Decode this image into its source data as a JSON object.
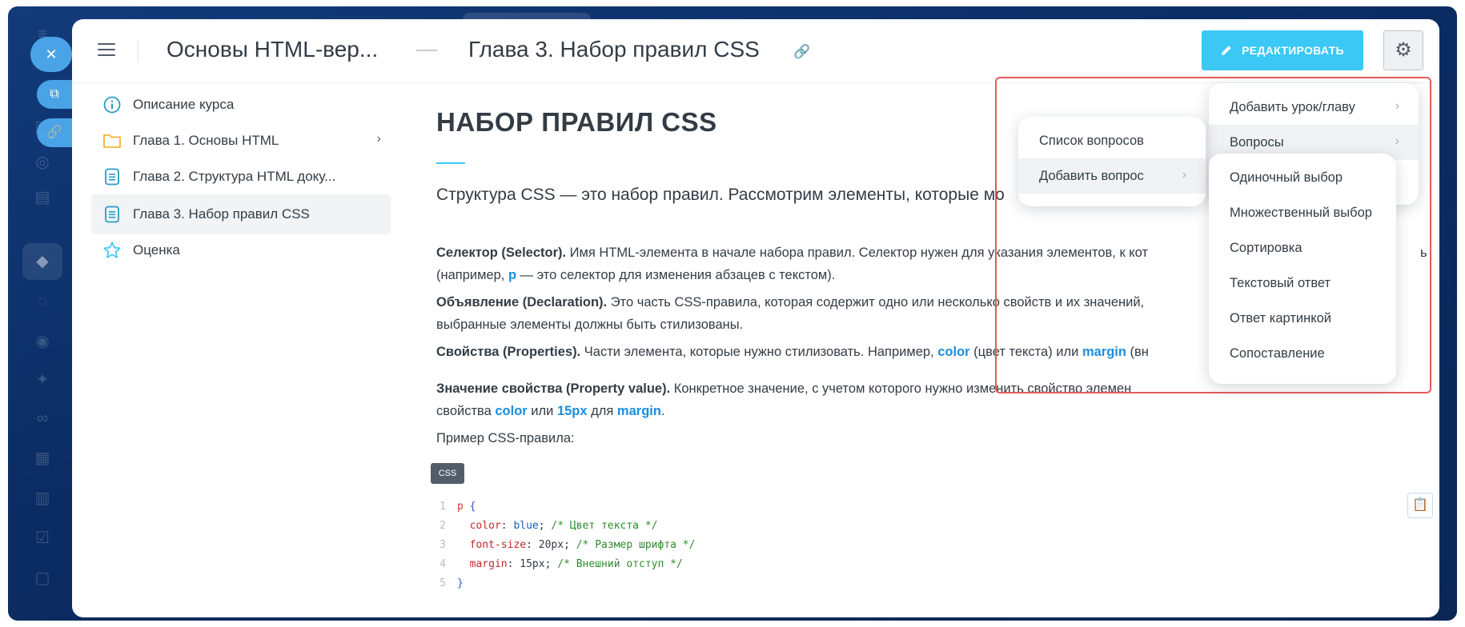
{
  "header": {
    "course_title": "Основы HTML-вер...",
    "chapter_title": "Глава 3. Набор правил CSS",
    "edit_button": "РЕДАКТИРОВАТЬ"
  },
  "sidebar": {
    "items": [
      {
        "label": "Описание курса",
        "icon": "info-icon"
      },
      {
        "label": "Глава 1. Основы HTML",
        "icon": "folder-icon",
        "has_children": true
      },
      {
        "label": "Глава 2. Структура HTML доку...",
        "icon": "document-icon"
      },
      {
        "label": "Глава 3. Набор правил CSS",
        "icon": "document-icon",
        "active": true
      },
      {
        "label": "Оценка",
        "icon": "star-icon"
      }
    ]
  },
  "content": {
    "heading": "НАБОР ПРАВИЛ CSS",
    "lead": "Структура CSS — это набор правил. Рассмотрим элементы, которые мо",
    "p1": {
      "term": "Селектор (Selector).",
      "text1": " Имя HTML-элемента в начале набора правил. Селектор нужен для указания элементов, к кот",
      "text1_end": "ь",
      "text2a": "(например, ",
      "kw": "p",
      "text2b": " — это селектор для изменения абзацев с текстом)."
    },
    "p2": {
      "term": "Объявление (Declaration).",
      "text1": " Это часть CSS-правила, которая содержит одно или несколько свойств и их значений,",
      "text2": "выбранные элементы должны быть стилизованы."
    },
    "p3": {
      "term": "Свойства (Properties).",
      "text1": " Части элемента, которые нужно стилизовать. Например, ",
      "kw1": "color",
      "text2": " (цвет текста) или ",
      "kw2": "margin",
      "text3": " (вн"
    },
    "p4": {
      "term": "Значение свойства (Property value).",
      "text1": " Конкретное значение, с учетом которого нужно изменить свойство элемен",
      "text2a": "свойства ",
      "kw1": "color",
      "text2b": " или ",
      "kw2": "15px",
      "text2c": " для ",
      "kw3": "margin",
      "text2d": "."
    },
    "example_label": "Пример CSS-правила:",
    "code_lang": "CSS",
    "code": {
      "line_numbers": [
        "1",
        "2",
        "3",
        "4",
        "5"
      ],
      "selector": "p",
      "open_brace": "{",
      "close_brace": "}",
      "decl": [
        {
          "prop": "color",
          "value": "blue",
          "comment": "/* Цвет текста */"
        },
        {
          "prop": "font-size",
          "value": "20px",
          "comment": "/* Размер шрифта */"
        },
        {
          "prop": "margin",
          "value": "15px",
          "comment": "/* Внешний отступ */"
        }
      ]
    }
  },
  "menus": {
    "main": [
      "Добавить урок/главу",
      "Вопросы"
    ],
    "questions": [
      "Список вопросов",
      "Добавить вопрос"
    ],
    "question_types": [
      "Одиночный выбор",
      "Множественный выбор",
      "Сортировка",
      "Текстовый ответ",
      "Ответ картинкой",
      "Сопоставление"
    ]
  },
  "colors": {
    "accent": "#3bc8f5",
    "link": "#1b8de0",
    "highlight": "#e45a5a",
    "background": "#0b2c63"
  }
}
